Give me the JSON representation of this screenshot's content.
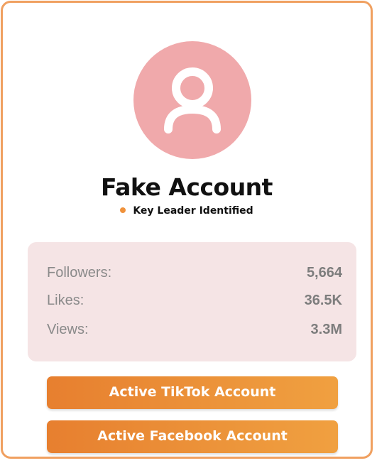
{
  "profile": {
    "name": "Fake Account",
    "status": "Key Leader Identified",
    "avatar_icon": "user-icon"
  },
  "stats": [
    {
      "label": "Followers:",
      "value": "5,664"
    },
    {
      "label": "Likes:",
      "value": "36.5K"
    },
    {
      "label": "Views:",
      "value": "3.3M"
    }
  ],
  "buttons": {
    "tiktok_label": "Active TikTok Account",
    "facebook_label": "Active Facebook Account"
  },
  "colors": {
    "accent": "#ec8a35",
    "avatar_bg": "#f0a9ab",
    "stats_bg": "#f5e4e5",
    "status_dot": "#f0923c"
  }
}
